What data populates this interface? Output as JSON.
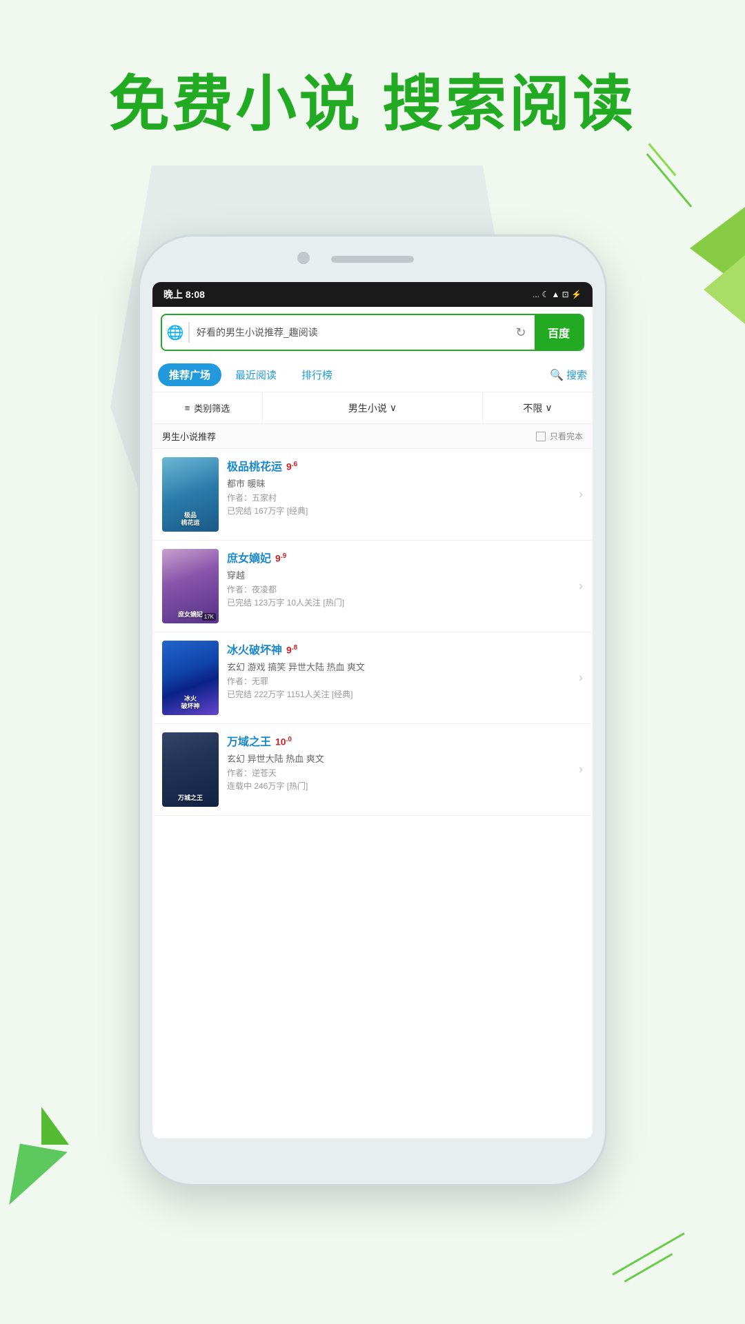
{
  "headline": {
    "line1": "免费小说  搜索阅读"
  },
  "statusBar": {
    "time": "晚上 8:08",
    "icons": "... ☾ ▲ ⊡ ⚡"
  },
  "searchBar": {
    "placeholder": "好看的男生小说推荐_趣阅读",
    "baidu_label": "百度",
    "globe_icon": "🌐",
    "refresh_icon": "↻"
  },
  "navTabs": [
    {
      "label": "推荐广场",
      "active": true
    },
    {
      "label": "最近阅读",
      "active": false
    },
    {
      "label": "排行榜",
      "active": false
    },
    {
      "label": "搜索",
      "active": false,
      "hasIcon": true
    }
  ],
  "filterRow": {
    "category_icon": "≡",
    "category_label": "类别筛选",
    "type_label": "男生小说",
    "type_arrow": "∨",
    "limit_label": "不限",
    "limit_arrow": "∨"
  },
  "sectionHeader": {
    "title": "男生小说推荐",
    "checkbox_label": "只看完本"
  },
  "books": [
    {
      "title": "极品桃花运",
      "rating": "9",
      "rating_sup": ".6",
      "tags": "都市 暖昧",
      "author": "作者：五家村",
      "meta": "已完结 167万字  [经典]",
      "cover_class": "cover-1",
      "cover_text": "极品\n桃花运"
    },
    {
      "title": "庶女嫡妃",
      "rating": "9",
      "rating_sup": ".9",
      "tags": "穿越",
      "author": "作者：夜凌都",
      "meta": "已完结 123万字 10人关注  [热门]",
      "cover_class": "cover-2",
      "cover_text": "庶女嫡妃",
      "cover_badge": "17K"
    },
    {
      "title": "冰火破坏神",
      "rating": "9",
      "rating_sup": ".8",
      "tags": "玄幻 游戏 搞笑 异世大陆 热血 爽文",
      "author": "作者：无罪",
      "meta": "已完结 222万字 1151人关注  [经典]",
      "cover_class": "cover-3",
      "cover_text": "冰火破坏神"
    },
    {
      "title": "万域之王",
      "rating": "10",
      "rating_sup": ".0",
      "tags": "玄幻 异世大陆 热血 爽文",
      "author": "作者：逆苍天",
      "meta": "连载中 246万字  [热门]",
      "cover_class": "cover-4",
      "cover_text": "万城之王"
    }
  ]
}
